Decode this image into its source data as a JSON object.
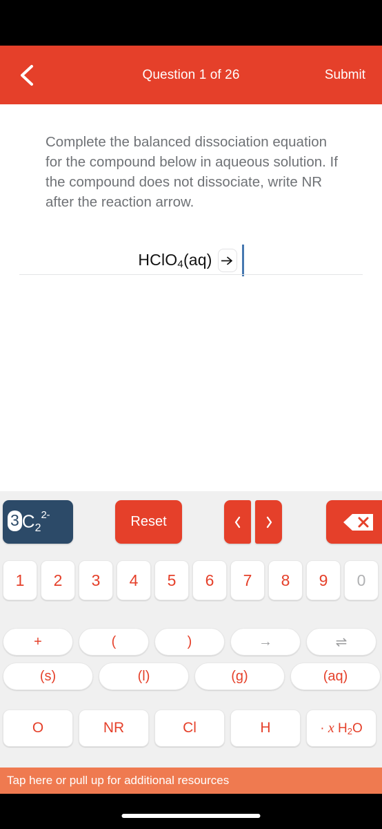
{
  "header": {
    "back_icon": "chevron-left-icon",
    "title": "Question 1 of 26",
    "submit_label": "Submit",
    "background_color": "#E5402A"
  },
  "question": {
    "prompt": "Complete the balanced dissociation equation for the compound below in aqueous solution. If the compound does not dissociate, write NR after the reaction arrow."
  },
  "equation": {
    "compound": "HClO",
    "compound_subscript": "4",
    "phase": "(aq)",
    "arrow_icon": "right-arrow-icon",
    "caret_color": "#4678b0"
  },
  "keypad": {
    "token": {
      "coefficient": "3",
      "element": "C",
      "subscript": "2",
      "superscript": "2-",
      "background_color": "#2C4A68"
    },
    "reset_label": "Reset",
    "prev_icon": "chevron-left-icon",
    "next_icon": "chevron-right-icon",
    "backspace_icon": "backspace-delete-icon",
    "numbers": [
      {
        "label": "1",
        "disabled": false
      },
      {
        "label": "2",
        "disabled": false
      },
      {
        "label": "3",
        "disabled": false
      },
      {
        "label": "4",
        "disabled": false
      },
      {
        "label": "5",
        "disabled": false
      },
      {
        "label": "6",
        "disabled": false
      },
      {
        "label": "7",
        "disabled": false
      },
      {
        "label": "8",
        "disabled": false
      },
      {
        "label": "9",
        "disabled": false
      },
      {
        "label": "0",
        "disabled": true
      }
    ],
    "operators": [
      {
        "label": "+",
        "name": "plus",
        "disabled": false
      },
      {
        "label": "(",
        "name": "open-paren",
        "disabled": false
      },
      {
        "label": ")",
        "name": "close-paren",
        "disabled": false
      },
      {
        "label": "→",
        "name": "reaction-arrow",
        "disabled": true
      },
      {
        "label": "⇌",
        "name": "equilibrium-arrow",
        "disabled": true
      }
    ],
    "states": [
      {
        "label": "(s)"
      },
      {
        "label": "(l)"
      },
      {
        "label": "(g)"
      },
      {
        "label": "(aq)"
      }
    ],
    "elements": [
      {
        "label": "O"
      },
      {
        "label": "NR"
      },
      {
        "label": "Cl"
      },
      {
        "label": "H"
      }
    ],
    "hydrate": {
      "dot": "·",
      "variable": "x",
      "formula": "H",
      "subscript": "2",
      "formula_end": "O"
    }
  },
  "resources": {
    "label": "Tap here or pull up for additional resources",
    "background_color": "#EF7A50"
  }
}
